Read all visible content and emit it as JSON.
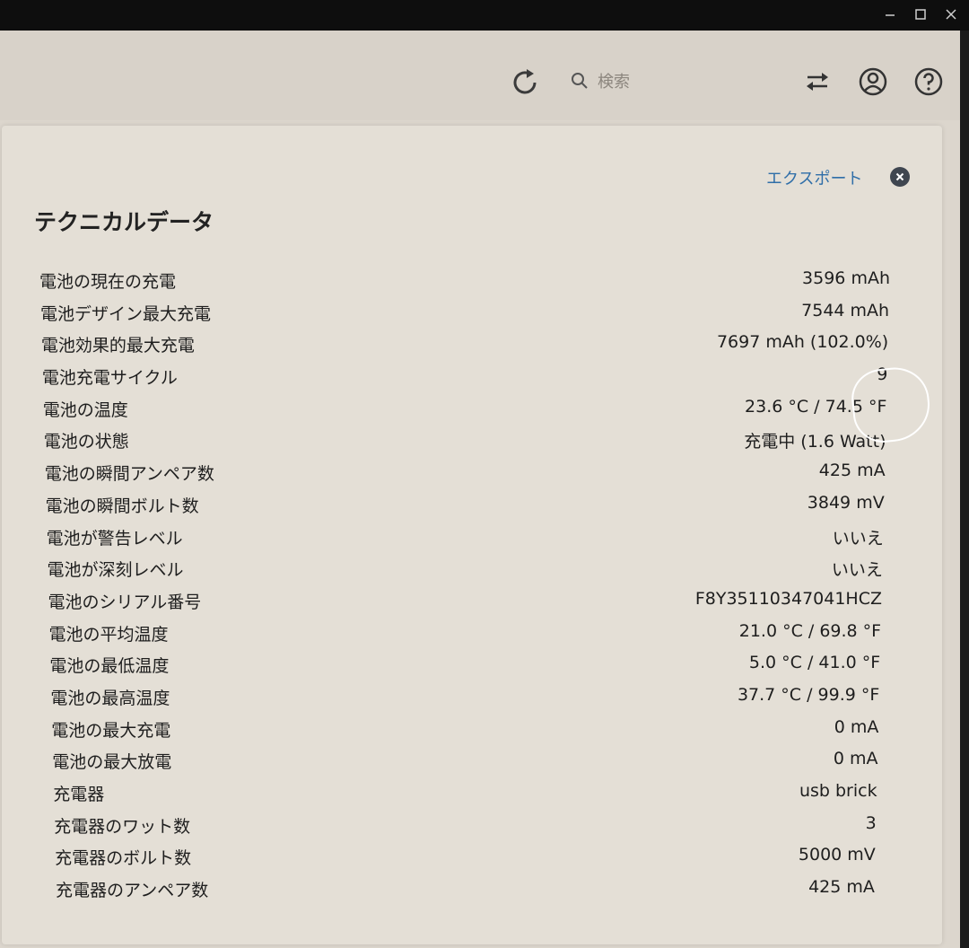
{
  "window": {
    "controls": [
      "minimize",
      "maximize",
      "close"
    ]
  },
  "header": {
    "search_placeholder": "検索",
    "icons": [
      "refresh-icon",
      "search-icon",
      "sync-icon",
      "account-icon",
      "help-icon"
    ]
  },
  "panel": {
    "export_label": "エクスポート",
    "title": "テクニカルデータ",
    "rows": [
      {
        "label": "電池の現在の充電",
        "value": "3596 mAh"
      },
      {
        "label": "電池デザイン最大充電",
        "value": "7544 mAh"
      },
      {
        "label": "電池効果的最大充電",
        "value": "7697 mAh (102.0%)"
      },
      {
        "label": "電池充電サイクル",
        "value": "9"
      },
      {
        "label": "電池の温度",
        "value": "23.6 °C / 74.5 °F"
      },
      {
        "label": "電池の状態",
        "value": "充電中 (1.6 Watt)"
      },
      {
        "label": "電池の瞬間アンペア数",
        "value": "425 mA"
      },
      {
        "label": "電池の瞬間ボルト数",
        "value": "3849 mV"
      },
      {
        "label": "電池が警告レベル",
        "value": "いいえ"
      },
      {
        "label": "電池が深刻レベル",
        "value": "いいえ"
      },
      {
        "label": "電池のシリアル番号",
        "value": "F8Y35110347041HCZ"
      },
      {
        "label": "電池の平均温度",
        "value": "21.0 °C / 69.8 °F"
      },
      {
        "label": "電池の最低温度",
        "value": "5.0 °C / 41.0 °F"
      },
      {
        "label": "電池の最高温度",
        "value": "37.7 °C / 99.9 °F"
      },
      {
        "label": "電池の最大充電",
        "value": "0 mA"
      },
      {
        "label": "電池の最大放電",
        "value": "0 mA"
      },
      {
        "label": "充電器",
        "value": "usb brick"
      },
      {
        "label": "充電器のワット数",
        "value": "3"
      },
      {
        "label": "充電器のボルト数",
        "value": "5000 mV"
      },
      {
        "label": "充電器のアンペア数",
        "value": "425 mA"
      }
    ]
  },
  "colors": {
    "panel_bg": "#e4dfd6",
    "link": "#2f6ea8",
    "text": "#1e1e1e"
  }
}
